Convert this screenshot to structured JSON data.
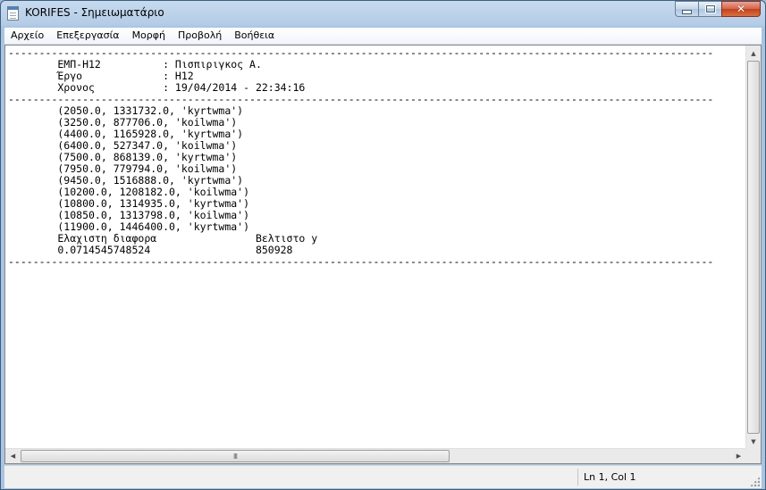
{
  "window": {
    "title": "KORIFES - Σημειωματάριο",
    "buttons": {
      "minimize": "minimize",
      "maximize": "maximize",
      "close": "close"
    }
  },
  "menu": [
    {
      "label": "Αρχείο"
    },
    {
      "label": "Επεξεργασία"
    },
    {
      "label": "Μορφή"
    },
    {
      "label": "Προβολή"
    },
    {
      "label": "Βοήθεια"
    }
  ],
  "document": {
    "lines": [
      "------------------------------------------------------------------------------------------------------------------",
      "        ΕΜΠ-Η12          : Πισπιριγκος Α.",
      "        Έργο             : Η12",
      "        Χρονος           : 19/04/2014 - 22:34:16",
      "------------------------------------------------------------------------------------------------------------------",
      "        (2050.0, 1331732.0, 'kyrtwma')",
      "        (3250.0, 877706.0, 'koilwma')",
      "        (4400.0, 1165928.0, 'kyrtwma')",
      "        (6400.0, 527347.0, 'koilwma')",
      "        (7500.0, 868139.0, 'kyrtwma')",
      "        (7950.0, 779794.0, 'koilwma')",
      "        (9450.0, 1516888.0, 'kyrtwma')",
      "        (10200.0, 1208182.0, 'koilwma')",
      "        (10800.0, 1314935.0, 'kyrtwma')",
      "        (10850.0, 1313798.0, 'koilwma')",
      "        (11900.0, 1446400.0, 'kyrtwma')",
      "        Ελαχιστη διαφορα                Βελτιστο y",
      "        0.0714545748524                 850928",
      "------------------------------------------------------------------------------------------------------------------"
    ]
  },
  "scrollbars": {
    "vertical": {
      "up_icon": "scroll-up-arrow-icon",
      "down_icon": "scroll-down-arrow-icon"
    },
    "horizontal": {
      "left_icon": "scroll-left-arrow-icon",
      "right_icon": "scroll-right-arrow-icon",
      "grip": "III"
    }
  },
  "status": {
    "position": "Ln 1, Col 1"
  },
  "colors": {
    "title_bar": "#b9d1ea",
    "close_button": "#c7432a",
    "editor_background": "#ffffff",
    "text": "#000000"
  }
}
